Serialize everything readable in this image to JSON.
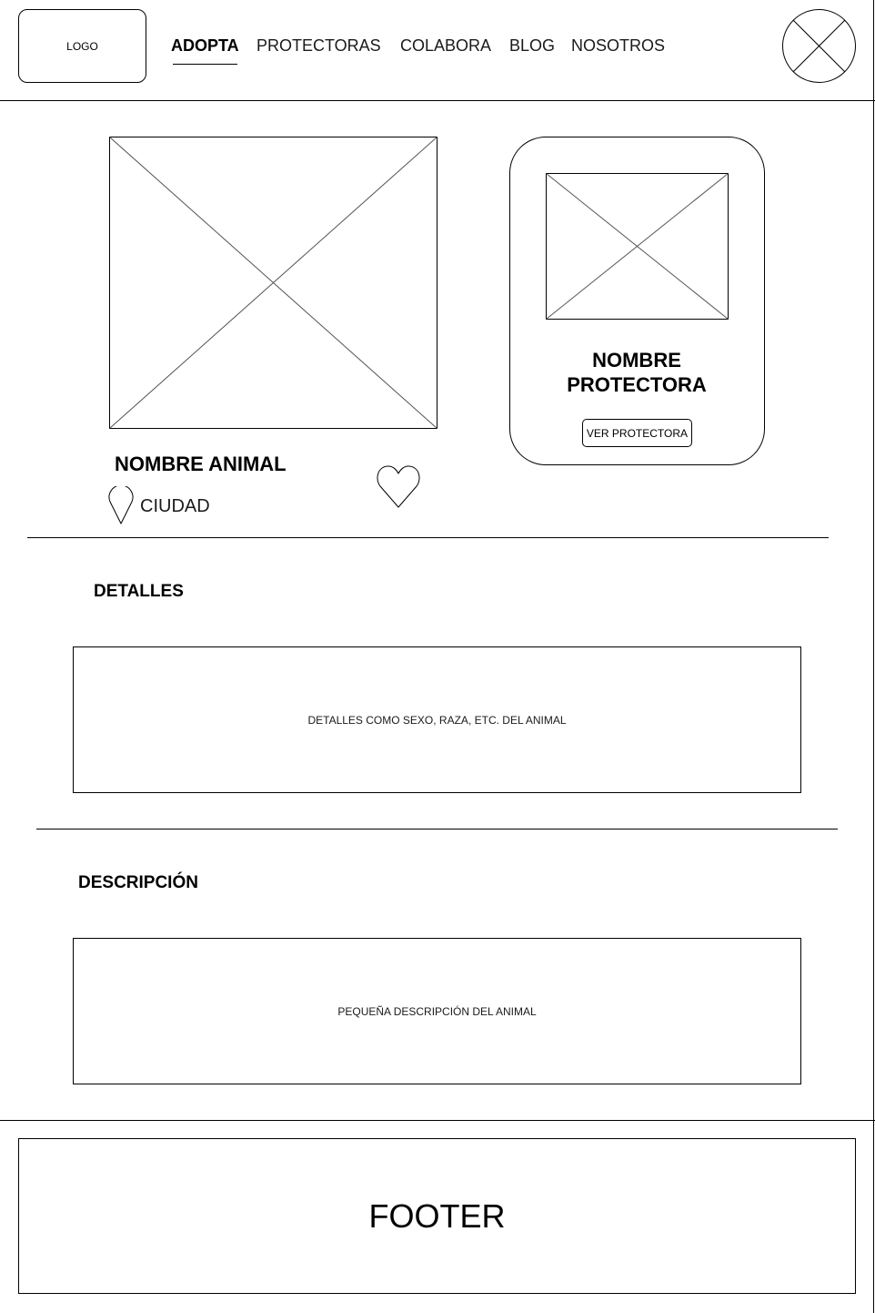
{
  "header": {
    "logo_label": "LOGO",
    "nav": [
      {
        "label": "ADOPTA",
        "active": true
      },
      {
        "label": "PROTECTORAS",
        "active": false
      },
      {
        "label": "COLABORA",
        "active": false
      },
      {
        "label": "BLOG",
        "active": false
      },
      {
        "label": "NOSOTROS",
        "active": false
      }
    ],
    "avatar_icon": "image-placeholder-icon"
  },
  "animal": {
    "image_icon": "image-placeholder-icon",
    "name": "NOMBRE ANIMAL",
    "city": "CIUDAD",
    "location_icon": "map-pin-icon",
    "favorite_icon": "heart-icon"
  },
  "protector_card": {
    "image_icon": "image-placeholder-icon",
    "name_line1": "NOMBRE",
    "name_line2": "PROTECTORA",
    "button_label": "VER PROTECTORA"
  },
  "details": {
    "title": "DETALLES",
    "content": "DETALLES COMO SEXO, RAZA, ETC. DEL ANIMAL"
  },
  "description": {
    "title": "DESCRIPCIÓN",
    "content": "PEQUEÑA DESCRIPCIÓN DEL ANIMAL"
  },
  "footer": {
    "label": "FOOTER"
  }
}
